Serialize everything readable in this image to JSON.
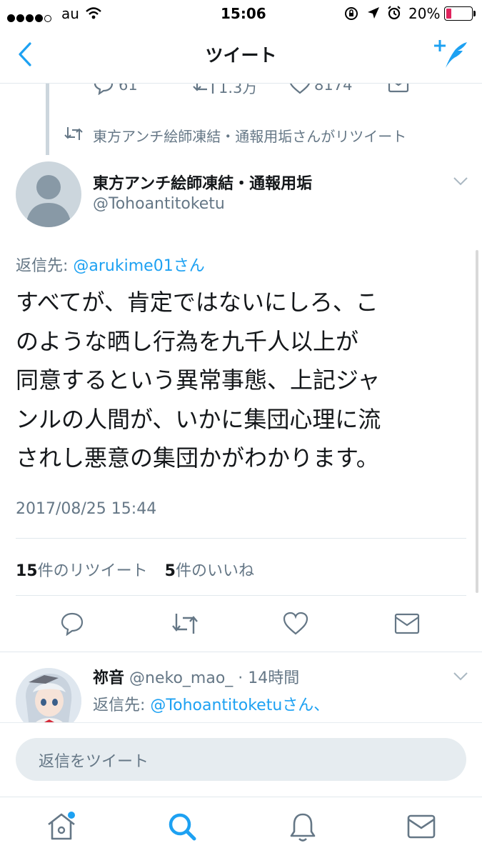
{
  "status_bar": {
    "carrier": "au",
    "time": "15:06",
    "battery": "20%"
  },
  "nav": {
    "title": "ツイート"
  },
  "prev_tweet": {
    "reply_count": "61",
    "retweet_count": "1.3万",
    "like_count": "8174"
  },
  "retweet_context": {
    "text": "東方アンチ絵師凍結・通報用垢さんがリツイート"
  },
  "tweet": {
    "display_name": "東方アンチ絵師凍結・通報用垢",
    "handle": "@Tohoantitoketu",
    "reply_prefix": "返信先: ",
    "reply_to": "@arukime01さん",
    "lines": [
      "すべてが、肯定ではないにしろ、こ",
      "のような晒し行為を九千人以上が",
      "同意するという異常事態、上記ジャ",
      "ンルの人間が、いかに集団心理に流",
      "されし悪意の集団かがわかります。"
    ],
    "timestamp": "2017/08/25 15:44",
    "retweets_num": "15",
    "retweets_label": "件のリツイート",
    "likes_num": "5",
    "likes_label": "件のいいね"
  },
  "reply_tweet": {
    "display_name": "祢音",
    "handle_time": " @neko_mao_ · 14時間",
    "reply_prefix": "返信先: ",
    "reply_to": "@Tohoantitoketuさん、"
  },
  "compose": {
    "placeholder": "返信をツイート"
  },
  "colors": {
    "accent": "#1da1f2",
    "muted": "#657786",
    "battery_low": "#e0245e"
  }
}
